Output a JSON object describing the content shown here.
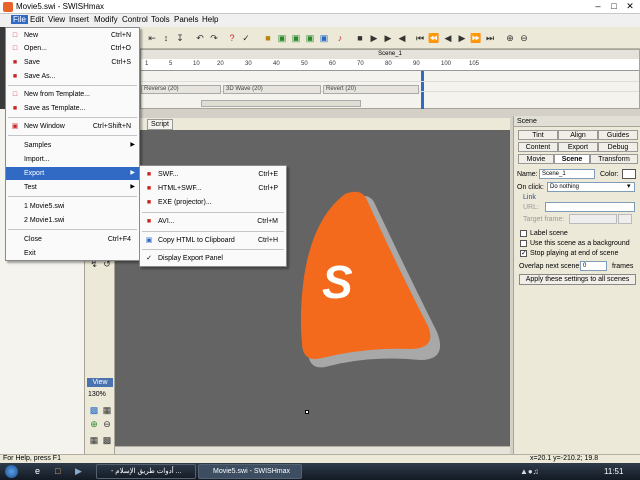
{
  "window": {
    "title": "Movie5.swi - SWISHmax"
  },
  "menubar": {
    "items": [
      "File",
      "Edit",
      "View",
      "Insert",
      "Modify",
      "Control",
      "Tools",
      "Panels",
      "Help"
    ]
  },
  "timeline": {
    "scene_label": "Scene_1",
    "ruler": [
      "1",
      "5",
      "10",
      "15",
      "20",
      "25",
      "30",
      "35",
      "40",
      "45",
      "50",
      "55",
      "60",
      "65",
      "70",
      "75",
      "80",
      "85",
      "90",
      "95",
      "100",
      "105"
    ],
    "effects": [
      "Reverse (20)",
      "3D Wave (20)",
      "Revert (20)"
    ]
  },
  "file_menu": {
    "items": [
      {
        "label": "New",
        "shortcut": "Ctrl+N"
      },
      {
        "label": "Open...",
        "shortcut": "Ctrl+O"
      },
      {
        "label": "Save",
        "shortcut": "Ctrl+S"
      },
      {
        "label": "Save As...",
        "shortcut": ""
      },
      {
        "label": "New from Template...",
        "shortcut": ""
      },
      {
        "label": "Save as Template...",
        "shortcut": ""
      },
      {
        "label": "New Window",
        "shortcut": "Ctrl+Shift+N"
      },
      {
        "label": "Samples",
        "shortcut": ""
      },
      {
        "label": "Import...",
        "shortcut": ""
      },
      {
        "label": "Export",
        "shortcut": ""
      },
      {
        "label": "Test",
        "shortcut": ""
      },
      {
        "label": "1 Movie5.swi",
        "shortcut": ""
      },
      {
        "label": "2 Movie1.swi",
        "shortcut": ""
      },
      {
        "label": "Close",
        "shortcut": "Ctrl+F4"
      },
      {
        "label": "Exit",
        "shortcut": ""
      }
    ]
  },
  "export_menu": {
    "items": [
      {
        "label": "SWF...",
        "shortcut": "Ctrl+E",
        "icon": "SWF"
      },
      {
        "label": "HTML+SWF...",
        "shortcut": "Ctrl+P",
        "icon": "HTML"
      },
      {
        "label": "EXE (projector)...",
        "shortcut": "",
        "icon": "EXE"
      },
      {
        "label": "AVI...",
        "shortcut": "Ctrl+M",
        "icon": "AVI"
      },
      {
        "label": "Copy HTML to Clipboard",
        "shortcut": "Ctrl+H",
        "icon": "clipboard-icon"
      },
      {
        "label": "Display Export Panel",
        "shortcut": "",
        "icon": "check-icon"
      }
    ]
  },
  "stage": {
    "tabs": [
      "Script"
    ],
    "logo_letter": "S"
  },
  "toolbox": {
    "view_label": "View",
    "zoom": "130%"
  },
  "right_panel": {
    "header": "Scene",
    "tabs_row1": [
      "Tint",
      "Align",
      "Guides"
    ],
    "tabs_row2": [
      "Content",
      "Export",
      "Debug"
    ],
    "tabs_row3": [
      "Movie",
      "Scene",
      "Transform"
    ],
    "name_label": "Name:",
    "name_value": "Scene_1",
    "color_label": "Color:",
    "onclick_label": "On click:",
    "onclick_value": "Do nothing",
    "link_label": "Link",
    "url_label": "URL:",
    "target_label": "Target frame:",
    "label_scene": "Label scene",
    "use_bg": "Use this scene as a background",
    "stop_playing": "Stop playing at end of scene",
    "overlap_label": "Overlap next scene:",
    "overlap_value": "0",
    "frames_label": "frames",
    "apply_btn": "Apply these settings to all scenes"
  },
  "status": {
    "help": "For Help, press F1",
    "coords": "x=20.1 y=-210.2; 19.8"
  },
  "taskbar": {
    "items": [
      "- أدوات طريق الإسلام ...",
      "Movie5.swi - SWISHmax"
    ],
    "clock": "11:51"
  },
  "colors": {
    "accent": "#316ac5",
    "logo_orange": "#f36a1c",
    "stage_bg": "#646464"
  }
}
